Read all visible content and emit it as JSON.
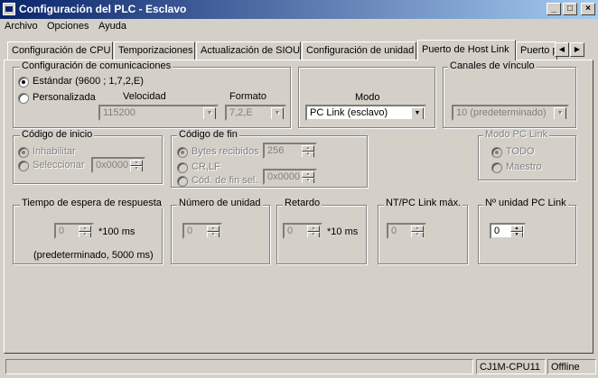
{
  "window": {
    "title": "Configuración del PLC - Esclavo",
    "minimize": "_",
    "maximize": "□",
    "close": "×"
  },
  "menu": {
    "items": [
      "Archivo",
      "Opciones",
      "Ayuda"
    ]
  },
  "tabs": [
    "Configuración de CPU",
    "Temporizaciones",
    "Actualización de SIOU",
    "Configuración de unidad",
    "Puerto de Host Link",
    "Puerto p"
  ],
  "tab_nav": {
    "prev": "◀",
    "next": "▶"
  },
  "comm": {
    "title": "Configuración de comunicaciones",
    "standard_label": "Estándar (9600 ; 1,7,2,E)",
    "custom_label": "Personalizada",
    "speed_label": "Velocidad",
    "speed_value": "115200",
    "format_label": "Formato",
    "format_value": "7,2,E"
  },
  "mode": {
    "label": "Modo",
    "value": "PC Link (esclavo)"
  },
  "link_channels": {
    "title": "Canales de vínculo",
    "value": "10 (predeterminado)"
  },
  "start_code": {
    "title": "Código de inicio",
    "disable_label": "Inhabilitar",
    "select_label": "Seleccionar",
    "value": "0x0000"
  },
  "end_code": {
    "title": "Código de fin",
    "bytes_label": "Bytes recibidos",
    "bytes_value": "256",
    "crlf_label": "CR,LF",
    "sel_label": "Cód. de fin sel.",
    "sel_value": "0x0000"
  },
  "pc_link_mode": {
    "title": "Modo PC Link",
    "all_label": "TODO",
    "master_label": "Maestro"
  },
  "response": {
    "title": "Tiempo de espera de respuesta",
    "value": "0",
    "unit": "*100 ms",
    "note": "(predeterminado, 5000 ms)"
  },
  "unit_number": {
    "title": "Número de unidad",
    "value": "0"
  },
  "delay": {
    "title": "Retardo",
    "value": "0",
    "unit": "*10 ms"
  },
  "nt_pc_max": {
    "title": "NT/PC Link máx.",
    "value": "0"
  },
  "pc_link_unit": {
    "title": "Nº unidad PC Link",
    "value": "0"
  },
  "status": {
    "model": "CJ1M-CPU11",
    "state": "Offline"
  }
}
